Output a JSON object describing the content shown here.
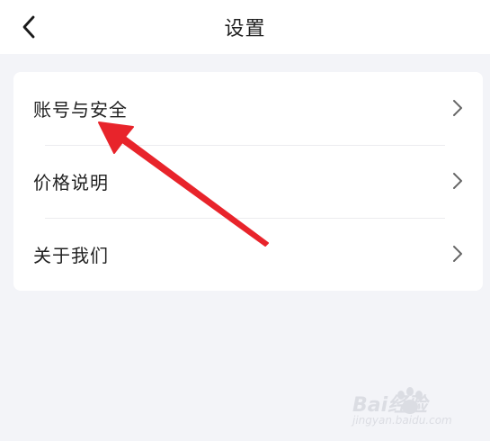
{
  "header": {
    "title": "设置",
    "back_icon": "chevron-left-icon"
  },
  "menu": {
    "items": [
      {
        "label": "账号与安全",
        "icon": "chevron-right-icon"
      },
      {
        "label": "价格说明",
        "icon": "chevron-right-icon"
      },
      {
        "label": "关于我们",
        "icon": "chevron-right-icon"
      }
    ]
  },
  "annotation": {
    "arrow_color": "#e8242b",
    "target": "账号与安全"
  },
  "watermark": {
    "main": "Bai经验",
    "sub": "jingyan.baidu.com"
  },
  "colors": {
    "background": "#f3f4f8",
    "card": "#ffffff",
    "text": "#222222",
    "chevron": "#666666"
  }
}
